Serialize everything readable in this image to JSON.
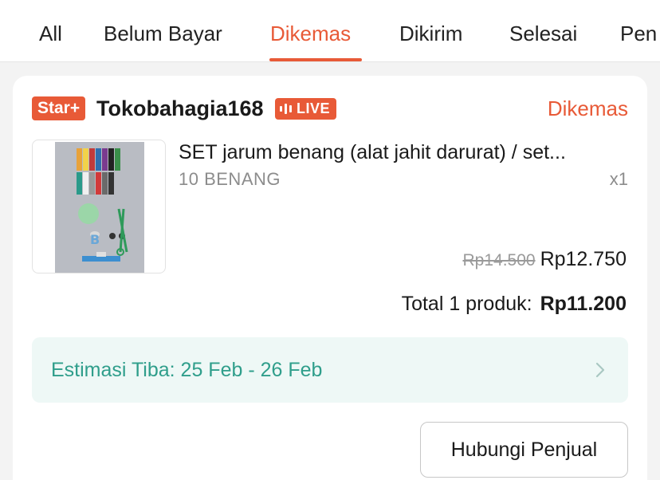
{
  "tabs": [
    {
      "label": "All"
    },
    {
      "label": "Belum Bayar"
    },
    {
      "label": "Dikemas"
    },
    {
      "label": "Dikirim"
    },
    {
      "label": "Selesai"
    },
    {
      "label": "Pen"
    }
  ],
  "active_tab": "Dikemas",
  "colors": {
    "accent": "#e85a37",
    "eta_text": "#2f9e8b",
    "eta_bg": "#eef8f6"
  },
  "order": {
    "badge": "Star+",
    "shop_name": "Tokobahagia168",
    "live_label": "LIVE",
    "status": "Dikemas",
    "product": {
      "name": "SET jarum benang (alat jahit darurat) / set...",
      "variant": "10 BENANG",
      "quantity": "x1",
      "original_price": "Rp14.500",
      "price": "Rp12.750",
      "image_icon": "sewing-kit-product-image"
    },
    "total_label": "Total 1 produk:",
    "total_value": "Rp11.200",
    "estimate": "Estimasi Tiba: 25 Feb - 26 Feb",
    "estimate_icon": "chevron-right-icon",
    "contact_button": "Hubungi Penjual"
  }
}
